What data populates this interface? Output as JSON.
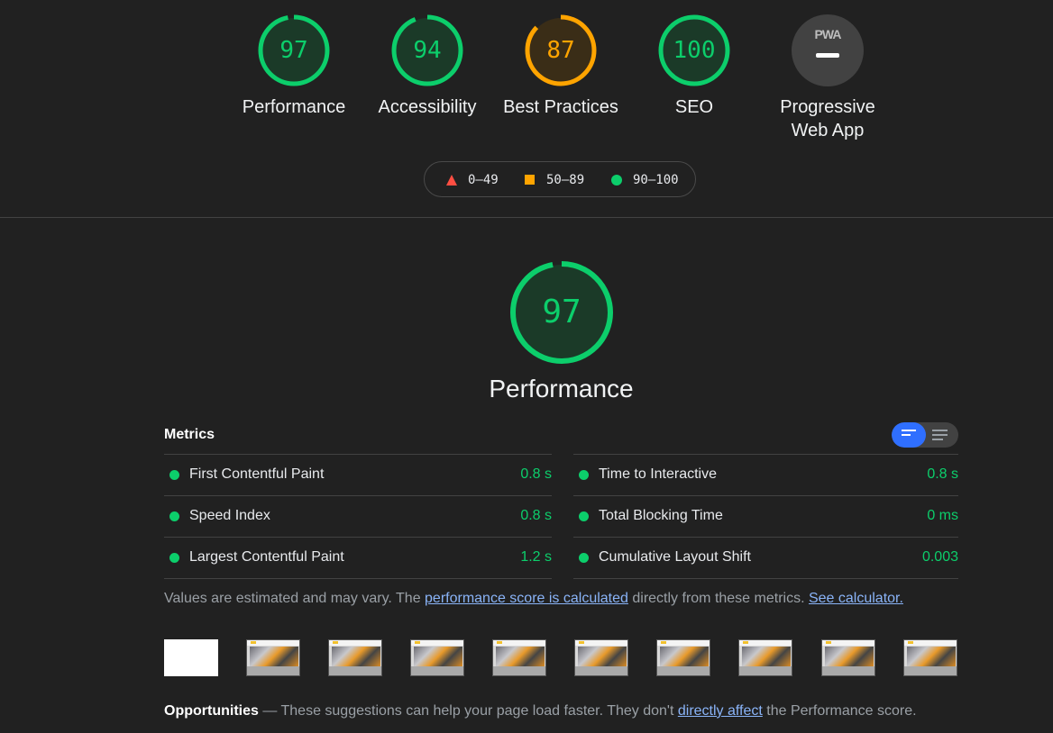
{
  "colors": {
    "pass": "#0cce6b",
    "average": "#ffa400",
    "fail": "#ff4e42",
    "link": "#8ab4f8",
    "background": "#212121"
  },
  "categories": [
    {
      "label": "Performance",
      "score": "97",
      "level": "pass"
    },
    {
      "label": "Accessibility",
      "score": "94",
      "level": "pass"
    },
    {
      "label": "Best Practices",
      "score": "87",
      "level": "average"
    },
    {
      "label": "SEO",
      "score": "100",
      "level": "pass"
    },
    {
      "label_line1": "Progressive",
      "label_line2": "Web App",
      "icon": "pwa-icon",
      "logo_text": "PWA"
    }
  ],
  "legend": {
    "fail": "0–49",
    "average": "50–89",
    "pass": "90–100"
  },
  "performance": {
    "score": "97",
    "title": "Performance"
  },
  "metrics": {
    "header": "Metrics",
    "left": [
      {
        "name": "First Contentful Paint",
        "value": "0.8 s"
      },
      {
        "name": "Speed Index",
        "value": "0.8 s"
      },
      {
        "name": "Largest Contentful Paint",
        "value": "1.2 s"
      }
    ],
    "right": [
      {
        "name": "Time to Interactive",
        "value": "0.8 s"
      },
      {
        "name": "Total Blocking Time",
        "value": "0 ms"
      },
      {
        "name": "Cumulative Layout Shift",
        "value": "0.003"
      }
    ]
  },
  "note": {
    "text1": "Values are estimated and may vary. The ",
    "link1": "performance score is calculated",
    "text2": " directly from these metrics. ",
    "link2": "See calculator."
  },
  "opportunities": {
    "title": "Opportunities",
    "text1": " — These suggestions can help your page load faster. They don't ",
    "link": "directly affect",
    "text2": " the Performance score."
  }
}
